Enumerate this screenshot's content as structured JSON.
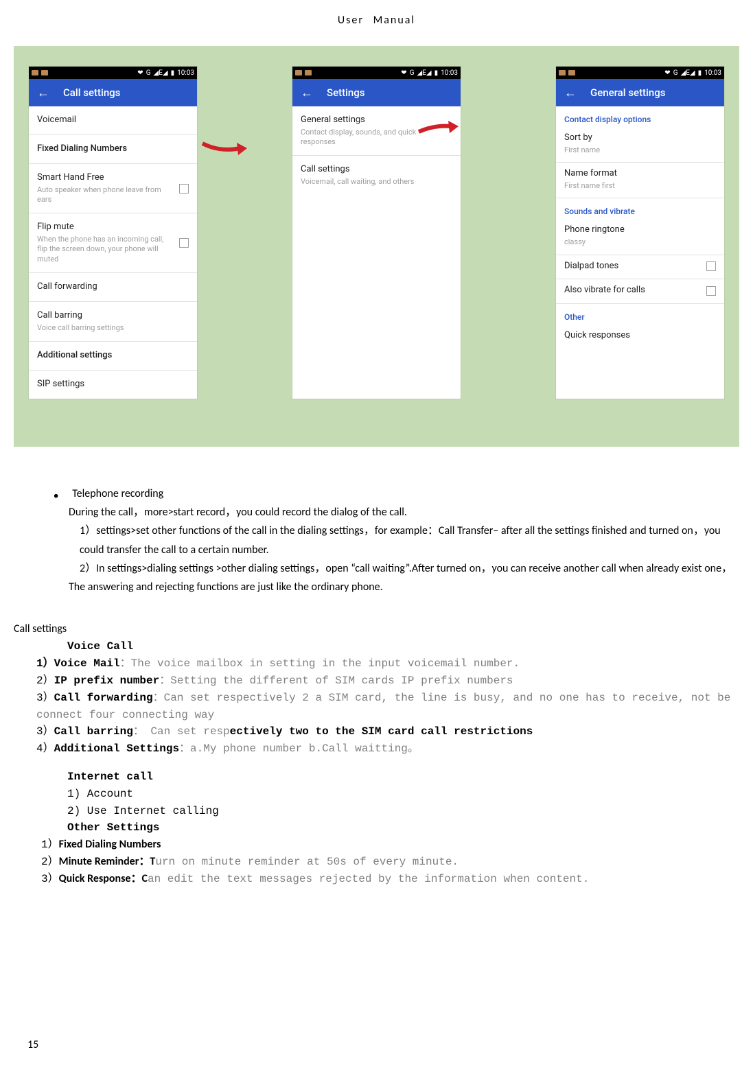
{
  "header": "User  Manual",
  "statusbar": {
    "time": "10:03",
    "right": "G"
  },
  "phone1": {
    "title": "Call settings",
    "rows": [
      {
        "title": "Voicemail"
      },
      {
        "title": "Fixed Dialing Numbers",
        "bold": true
      },
      {
        "title": "Smart Hand Free",
        "sub": "Auto speaker when phone leave from ears",
        "cb": true
      },
      {
        "title": "Flip mute",
        "sub": "When the phone has an incoming call, flip the screen down, your phone will muted",
        "cb": true
      },
      {
        "title": "Call forwarding"
      },
      {
        "title": "Call barring",
        "sub": "Voice call barring settings"
      },
      {
        "title": "Additional settings",
        "bold": true
      },
      {
        "title": "SIP settings"
      }
    ]
  },
  "phone2": {
    "title": "Settings",
    "rows": [
      {
        "title": "General settings",
        "sub": "Contact display, sounds, and quick responses"
      },
      {
        "title": "Call settings",
        "sub": "Voicemail, call waiting, and others"
      }
    ]
  },
  "phone3": {
    "title": "General settings",
    "groups": [
      {
        "head": "Contact display options",
        "rows": [
          {
            "title": "Sort by",
            "sub": "First name"
          },
          {
            "title": "Name format",
            "sub": "First name first"
          }
        ]
      },
      {
        "head": "Sounds and vibrate",
        "rows": [
          {
            "title": "Phone ringtone",
            "sub": "classy"
          },
          {
            "title": "Dialpad tones",
            "cb": true
          },
          {
            "title": "Also vibrate for calls",
            "cb": true
          }
        ]
      },
      {
        "head": "Other",
        "rows": [
          {
            "title": "Quick responses"
          }
        ]
      }
    ]
  },
  "body": {
    "bullet_title": "Telephone recording",
    "p1": "During the call，more>start record，you could record the dialog of the call.",
    "p2": "1）settings>set other functions of the call in the dialing settings，for example：Call Transfer– after all the settings finished and turned on，you could transfer the call to a certain number.",
    "p3": "2）In settings>dialing settings >other dialing settings，open “call waiting”.After turned on，you can receive another call when already exist one，The answering and rejecting functions are just like the ordinary phone.",
    "call_settings": "Call settings",
    "voice_call": "Voice Call",
    "l1_a": "1）V",
    "l1_b": "oice Mail",
    "l1_c": "：The voice mailbox in setting in the input voicemail number.",
    "l2_a": "2）",
    "l2_b": "IP prefix number",
    "l2_c": "：Setting the different of SIM cards IP prefix numbers",
    "l3_a": "3）",
    "l3_b": "Call forwarding",
    "l3_c": "：Can set respectively 2 a SIM card, the line is busy, and no one has to receive, not be connect four connecting way",
    "l4_a": "3）",
    "l4_b": "Call barring",
    "l4_c": "： Can set resp",
    "l4_d": "ectively two to the SIM card call restrictions",
    "l5_a": "4）",
    "l5_b": "Additional Settings",
    "l5_c": "：a.My phone number b.Call waitting。",
    "internet": "Internet call",
    "i1": "1)  Account",
    "i2": "2)  Use Internet calling",
    "other": "Other Settings",
    "o1_a": "1）",
    "o1_b": "Fixed Dialing Numbers",
    "o2_a": "2）",
    "o2_b": "Minute Reminder：T",
    "o2_c": "urn on minute reminder at 50s of every minute.",
    "o3_a": "3）",
    "o3_b": "Quick Response：C",
    "o3_c": "an edit the text messages rejected by the information when content."
  },
  "page_no": "15"
}
